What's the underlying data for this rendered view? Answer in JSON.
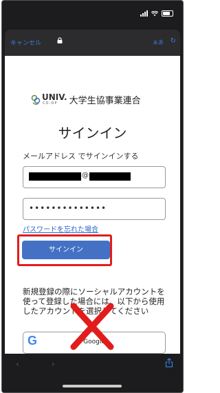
{
  "browser": {
    "cancel_label": "キャンセル",
    "text_size_label": "ぁあ",
    "reload_icon": "reload-icon"
  },
  "logo": {
    "univ": "UNIV.",
    "coop": "CO-OP",
    "org_name": "大学生協事業連合"
  },
  "signin": {
    "title": "サインイン",
    "subtitle": "メールアドレス でサインインする",
    "email_at": "@",
    "password_dots": "••••••••••••••",
    "forgot_link": "パスワードを忘れた場合",
    "button_label": "サインイン"
  },
  "social": {
    "notice": "新規登録の際にソーシャルアカウントを使って登録した場合には、以下から使用したアカウントを選択してください",
    "google_label": "Google"
  },
  "colors": {
    "accent": "#4471c4",
    "highlight": "#e21c1c",
    "link": "#2a63c7"
  }
}
